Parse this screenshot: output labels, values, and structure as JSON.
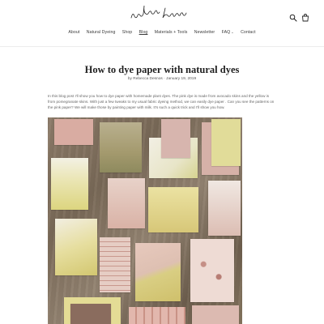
{
  "nav": {
    "items": [
      {
        "label": "About"
      },
      {
        "label": "Natural Dyeing"
      },
      {
        "label": "Shop"
      },
      {
        "label": "Blog"
      },
      {
        "label": "Materials + Tools"
      },
      {
        "label": "Newsletter"
      },
      {
        "label": "FAQ"
      },
      {
        "label": "Contact"
      }
    ],
    "faq_caret": "⌄"
  },
  "header": {
    "logo_icon": "signature-logo",
    "search_icon": "search-icon",
    "cart_icon": "bag-icon"
  },
  "article": {
    "title": "How to dye paper with natural dyes",
    "byline": "by Rebecca Desnos · January 19, 2019",
    "intro": "In this blog post I'll show you how to dye paper with homemade plant dyes. The pink dye is made from avocado skins and the yellow is from pomegranate skins. With just a few tweaks to my usual fabric dyeing method, we can easily dye paper . Can you see the patterns on the pink paper? We will make those by painting paper with milk. It's such a quick trick and I'll show you how."
  },
  "colors": {
    "text": "#3a3a3a",
    "wood": "#86765f",
    "pink": "#d8b4ac",
    "yellow": "#e3dc97"
  }
}
